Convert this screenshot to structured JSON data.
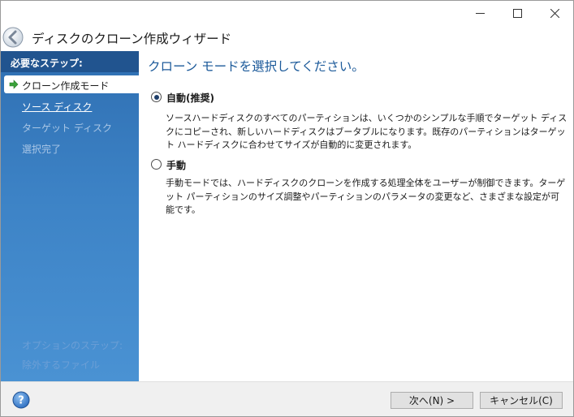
{
  "window": {
    "title": "ディスクのクローン作成ウィザード"
  },
  "sidebar": {
    "heading": "必要なステップ:",
    "steps": [
      {
        "label": "クローン作成モード",
        "state": "active"
      },
      {
        "label": "ソース ディスク",
        "state": "link"
      },
      {
        "label": "ターゲット ディスク",
        "state": "disabled"
      },
      {
        "label": "選択完了",
        "state": "disabled"
      }
    ],
    "faded_heading": "オプションのステップ:",
    "faded_item": "除外するファイル"
  },
  "main": {
    "title": "クローン モードを選択してください。",
    "options": [
      {
        "label": "自動(推奨)",
        "selected": true,
        "description": "ソースハードディスクのすべてのパーティションは、いくつかのシンプルな手順でターゲット ディスクにコピーされ、新しいハードディスクはブータブルになります。既存のパーティションはターゲット ハードディスクに合わせてサイズが自動的に変更されます。"
      },
      {
        "label": "手動",
        "selected": false,
        "description": "手動モードでは、ハードディスクのクローンを作成する処理全体をユーザーが制御できます。ターゲット パーティションのサイズ調整やパーティションのパラメータの変更など、さまざまな設定が可能です。"
      }
    ]
  },
  "footer": {
    "next_label": "次へ(N) >",
    "cancel_label": "キャンセル(C)"
  },
  "colors": {
    "sidebar_top": "#2f6fb2",
    "sidebar_bottom": "#4a92d3",
    "title_blue": "#1c5a9a",
    "footer_bg": "#f0f0f0"
  },
  "icons": {
    "back": "back-arrow-icon",
    "step_active": "green-arrow-icon",
    "help": "help-icon",
    "minimize": "minimize-icon",
    "maximize": "maximize-icon",
    "close": "close-icon"
  }
}
